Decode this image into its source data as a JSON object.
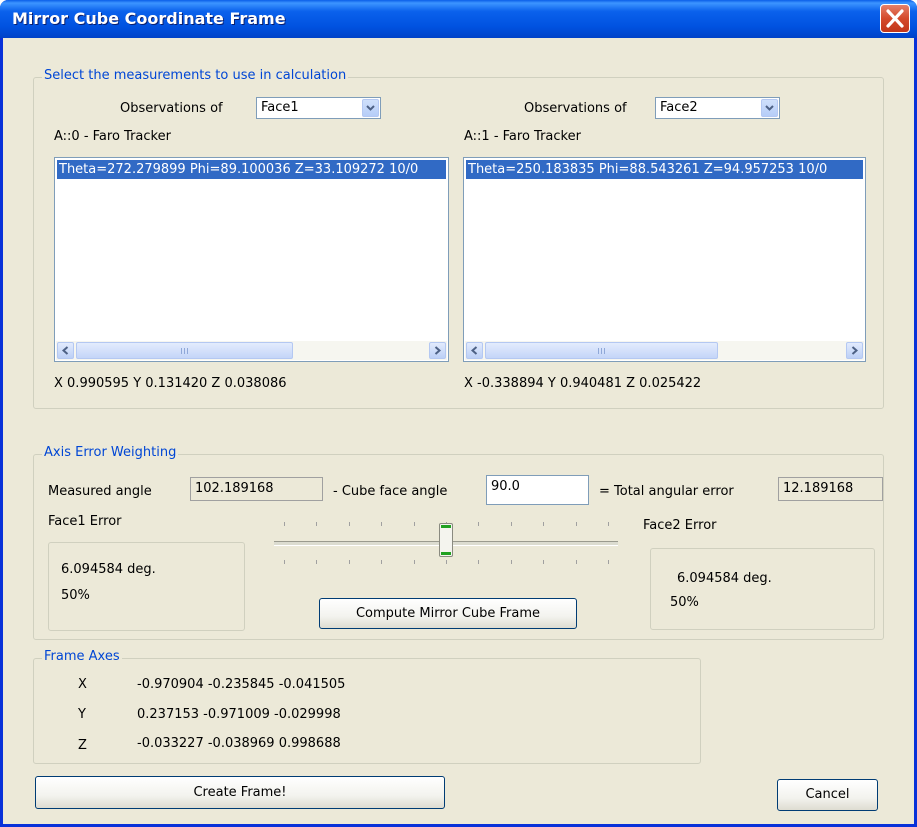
{
  "window": {
    "title": "Mirror Cube Coordinate Frame"
  },
  "select_group": {
    "label": "Select the measurements to use in calculation",
    "left": {
      "observations_label": "Observations of",
      "face": "Face1",
      "instrument": "A::0 - Faro Tracker",
      "list_items": [
        "Theta=272.279899  Phi=89.100036  Z=33.109272 10/0"
      ],
      "vector": "X 0.990595  Y 0.131420  Z 0.038086"
    },
    "right": {
      "observations_label": "Observations of",
      "face": "Face2",
      "instrument": "A::1 - Faro Tracker",
      "list_items": [
        "Theta=250.183835  Phi=88.543261  Z=94.957253 10/0"
      ],
      "vector": "X -0.338894  Y 0.940481  Z 0.025422"
    }
  },
  "axis_group": {
    "label": "Axis Error Weighting",
    "measured_angle_label": "Measured angle",
    "measured_angle": "102.189168",
    "cube_face_label": "- Cube face angle",
    "cube_face_angle": "90.0",
    "total_error_label": "= Total angular error",
    "total_error": "12.189168",
    "face1_label": "Face1 Error",
    "face1_deg": "6.094584 deg.",
    "face1_pct": "50%",
    "face2_label": "Face2 Error",
    "face2_deg": "6.094584 deg.",
    "face2_pct": "50%",
    "slider_value": 0.5,
    "compute_button": "Compute Mirror Cube Frame"
  },
  "frame_axes": {
    "label": "Frame Axes",
    "rows": [
      {
        "axis": "X",
        "values": "-0.970904  -0.235845  -0.041505"
      },
      {
        "axis": "Y",
        "values": "0.237153  -0.971009  -0.029998"
      },
      {
        "axis": "Z",
        "values": "-0.033227  -0.038969  0.998688"
      }
    ]
  },
  "buttons": {
    "create": "Create Frame!",
    "cancel": "Cancel"
  }
}
